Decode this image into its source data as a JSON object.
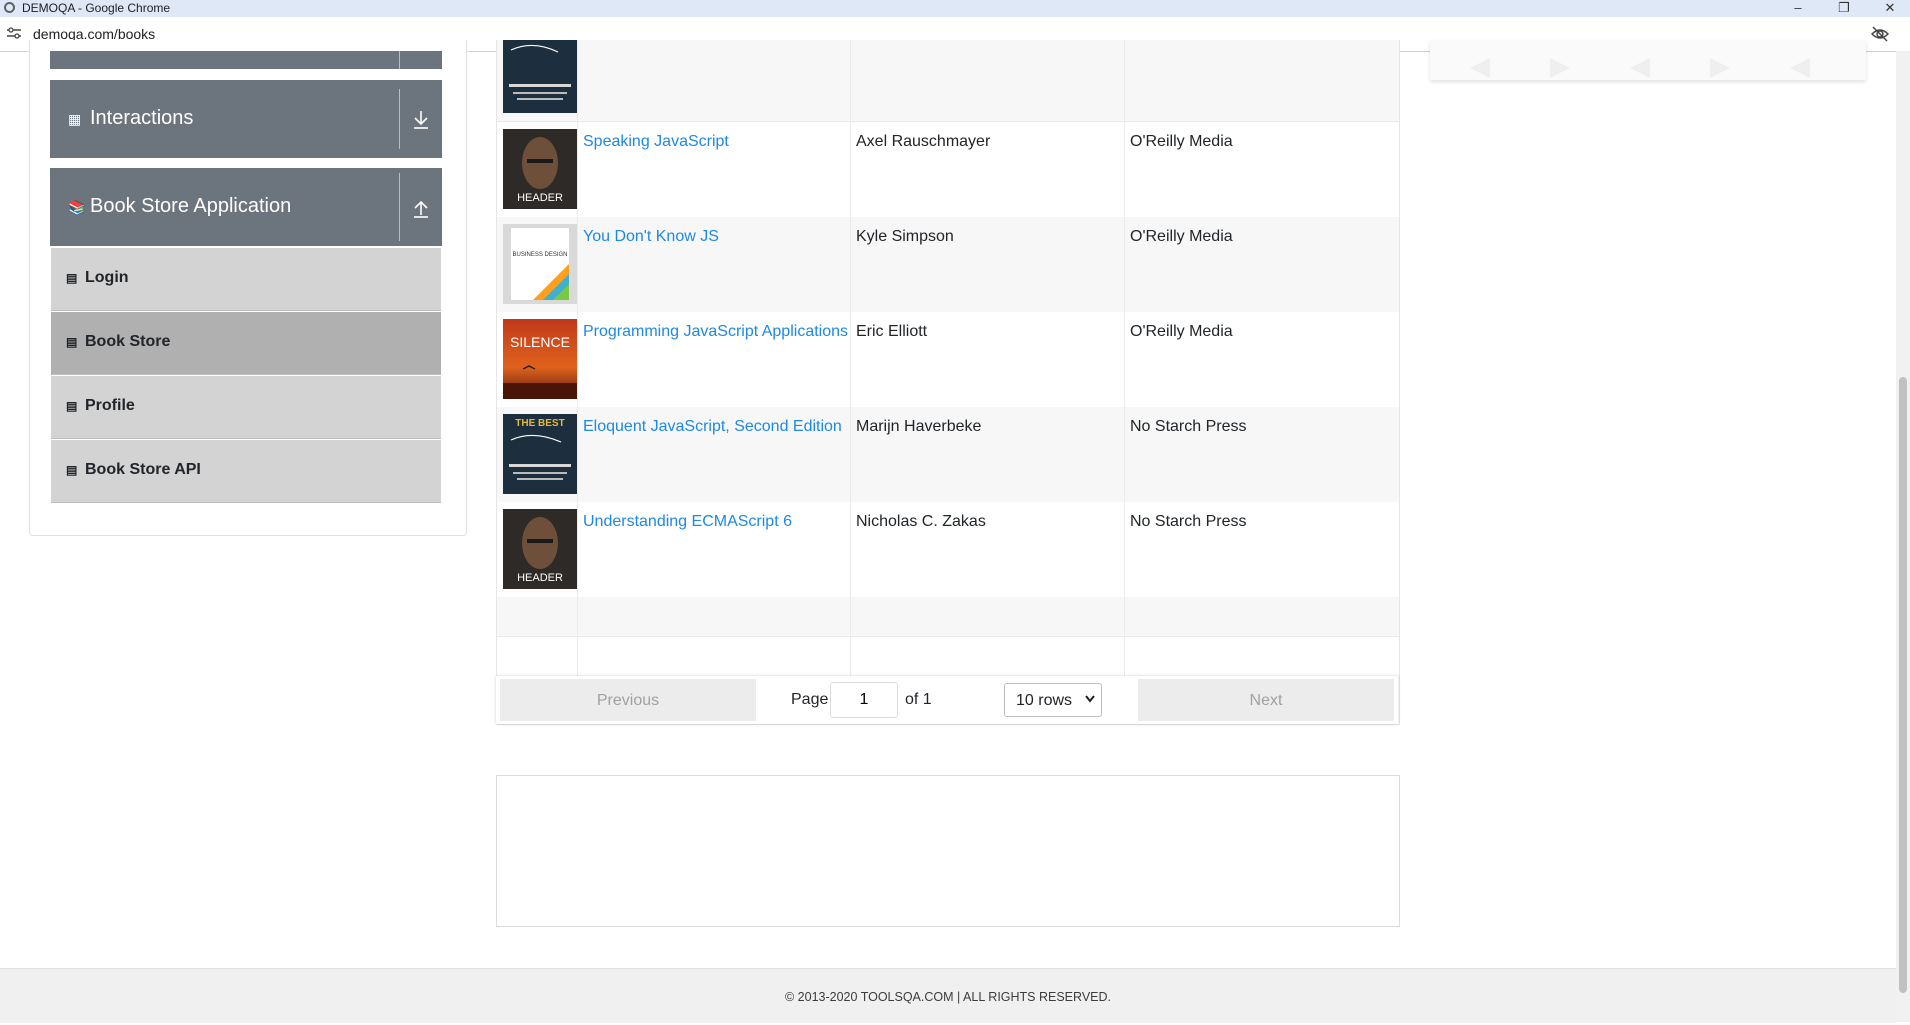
{
  "browser": {
    "window_title": "DEMOQA - Google Chrome",
    "url": "demoqa.com/books"
  },
  "sidebar": {
    "interactions_label": "Interactions",
    "bookstore_label": "Book Store Application",
    "items": [
      {
        "label": "Login"
      },
      {
        "label": "Book Store"
      },
      {
        "label": "Profile"
      },
      {
        "label": "Book Store API"
      }
    ]
  },
  "books": [
    {
      "title": "Speaking JavaScript",
      "author": "Axel Rauschmayer",
      "publisher": "O'Reilly Media"
    },
    {
      "title": "You Don't Know JS",
      "author": "Kyle Simpson",
      "publisher": "O'Reilly Media"
    },
    {
      "title": "Programming JavaScript Applications",
      "author": "Eric Elliott",
      "publisher": "O'Reilly Media"
    },
    {
      "title": "Eloquent JavaScript, Second Edition",
      "author": "Marijn Haverbeke",
      "publisher": "No Starch Press"
    },
    {
      "title": "Understanding ECMAScript 6",
      "author": "Nicholas C. Zakas",
      "publisher": "No Starch Press"
    }
  ],
  "pagination": {
    "previous": "Previous",
    "page_label": "Page",
    "page_value": "1",
    "of_label": "of 1",
    "rows_option": "10 rows",
    "next": "Next"
  },
  "cover_text": {
    "header": "HEADER",
    "silence": "SILENCE",
    "business": "BUSINESS DESIGN",
    "best": "THE BEST"
  },
  "footer": {
    "copyright": "© 2013-2020 TOOLSQA.COM | ALL RIGHTS RESERVED."
  },
  "colors": {
    "accent_link": "#1e88e5",
    "group_header": "#6c757d",
    "menu_item": "#d3d3d3",
    "menu_item_active": "#b0b0b0"
  }
}
